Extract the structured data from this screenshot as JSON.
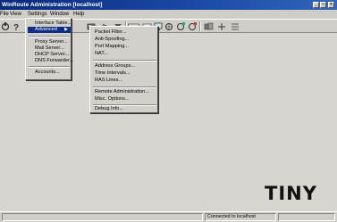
{
  "window": {
    "title": "WinRoute Administration [localhost]"
  },
  "menubar": [
    "File",
    "View",
    "Settings",
    "Window",
    "Help"
  ],
  "toolbar": {
    "icons": [
      "connect-icon",
      "help-icon",
      "server-icon",
      "ghost-icon",
      "filter-icon",
      "nat-icon",
      "card-icon",
      "net-icon",
      "computer-icon",
      "network-icon",
      "nat2-icon",
      "computers-icon",
      "mail-icon"
    ],
    "labels": {
      "card": "NAT"
    }
  },
  "settings_menu": {
    "items": [
      "Interface Table...",
      "Advanced",
      "Proxy Server...",
      "Mail Server...",
      "DHCP Server...",
      "DNS Forwarder...",
      "Accounts..."
    ]
  },
  "advanced_menu": {
    "items": [
      "Packet Filter...",
      "Anti-Spoofing...",
      "Port Mapping...",
      "NAT...",
      "Address Groups...",
      "Time Intervals...",
      "RAS Lines...",
      "Remote Administration...",
      "Misc. Options...",
      "Debug Info..."
    ]
  },
  "logo": "TINY",
  "statusbar": {
    "connection": "Connected to localhost"
  }
}
